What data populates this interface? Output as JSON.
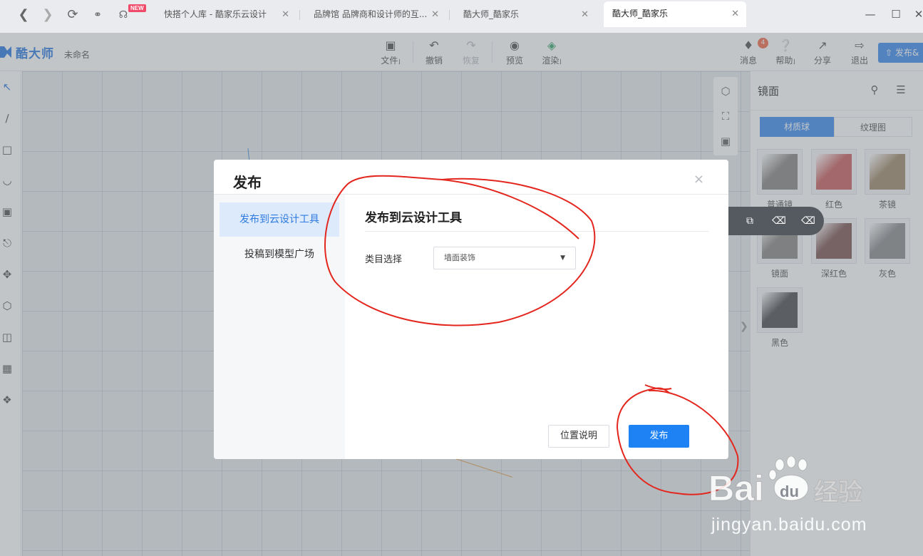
{
  "browser": {
    "new_badge": "NEW",
    "tabs": [
      {
        "label": "快搭个人库 - 酷家乐云设计"
      },
      {
        "label": "品牌馆 品牌商和设计师的互..."
      },
      {
        "label": "酷大师_酷家乐"
      },
      {
        "label": "酷大师_酷家乐"
      }
    ]
  },
  "app": {
    "logo_text": "酷大师",
    "doc_name": "未命名",
    "toolbar": {
      "file": "文件",
      "undo": "撤销",
      "redo": "恢复",
      "preview": "预览",
      "render": "渲染",
      "messages": "消息",
      "message_count": "4",
      "help": "帮助",
      "share": "分享",
      "exit": "退出",
      "publish": "发布&"
    }
  },
  "right_panel": {
    "title": "镜面",
    "tabs": [
      "材质球",
      "纹理图"
    ],
    "materials": [
      {
        "label": "普通镜",
        "color": "#8a8784"
      },
      {
        "label": "红色",
        "color": "#c9605f"
      },
      {
        "label": "茶镜",
        "color": "#a08a6c"
      },
      {
        "label": "镜面",
        "color": "#8c8985"
      },
      {
        "label": "深红色",
        "color": "#7e5654"
      },
      {
        "label": "灰色",
        "color": "#8c8d8e"
      },
      {
        "label": "黑色",
        "color": "#4f4f50"
      }
    ]
  },
  "modal": {
    "title": "发布",
    "close": "×",
    "menu": [
      "发布到云设计工具",
      "投稿到模型广场"
    ],
    "content_title": "发布到云设计工具",
    "category_label": "类目选择",
    "category_value": "墙面装饰",
    "help_button": "位置说明",
    "publish_button": "发布"
  },
  "watermark": {
    "brand": "Bai du 经验",
    "url": "jingyan.baidu.com"
  }
}
